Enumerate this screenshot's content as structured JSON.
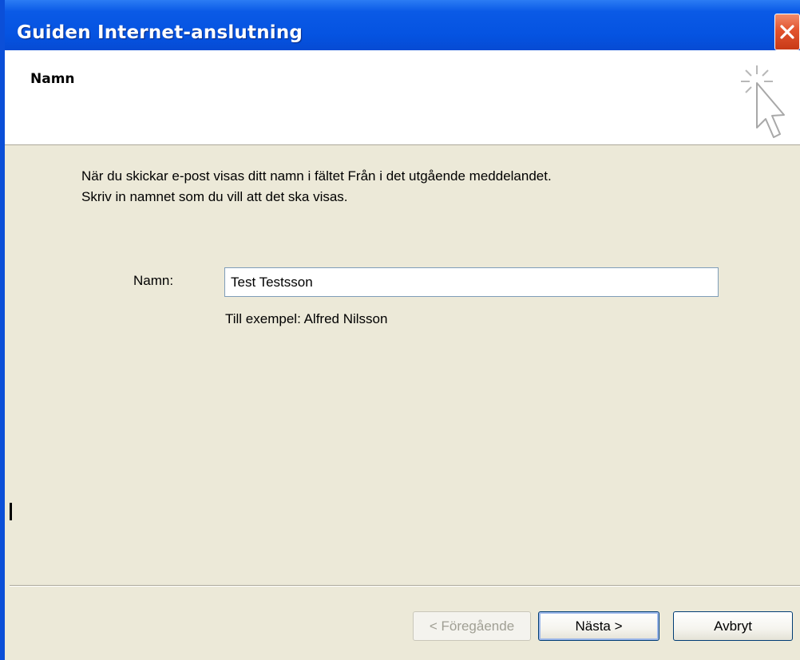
{
  "window": {
    "title": "Guiden Internet-anslutning"
  },
  "header": {
    "title": "Namn",
    "icon": "wizard-cursor-icon"
  },
  "content": {
    "description_line1": "När du skickar e-post visas ditt namn i fältet Från i det utgående meddelandet.",
    "description_line2": "Skriv in namnet som du vill att det ska visas.",
    "name_label": "Namn:",
    "name_value": "Test Testsson",
    "example_text": "Till exempel: Alfred Nilsson"
  },
  "buttons": {
    "previous": "< Föregående",
    "next": "Nästa >",
    "cancel": "Avbryt"
  },
  "colors": {
    "titlebar": "#0553e1",
    "close_button": "#e2532e",
    "dialog_background": "#ece9d8",
    "header_background": "#ffffff"
  }
}
